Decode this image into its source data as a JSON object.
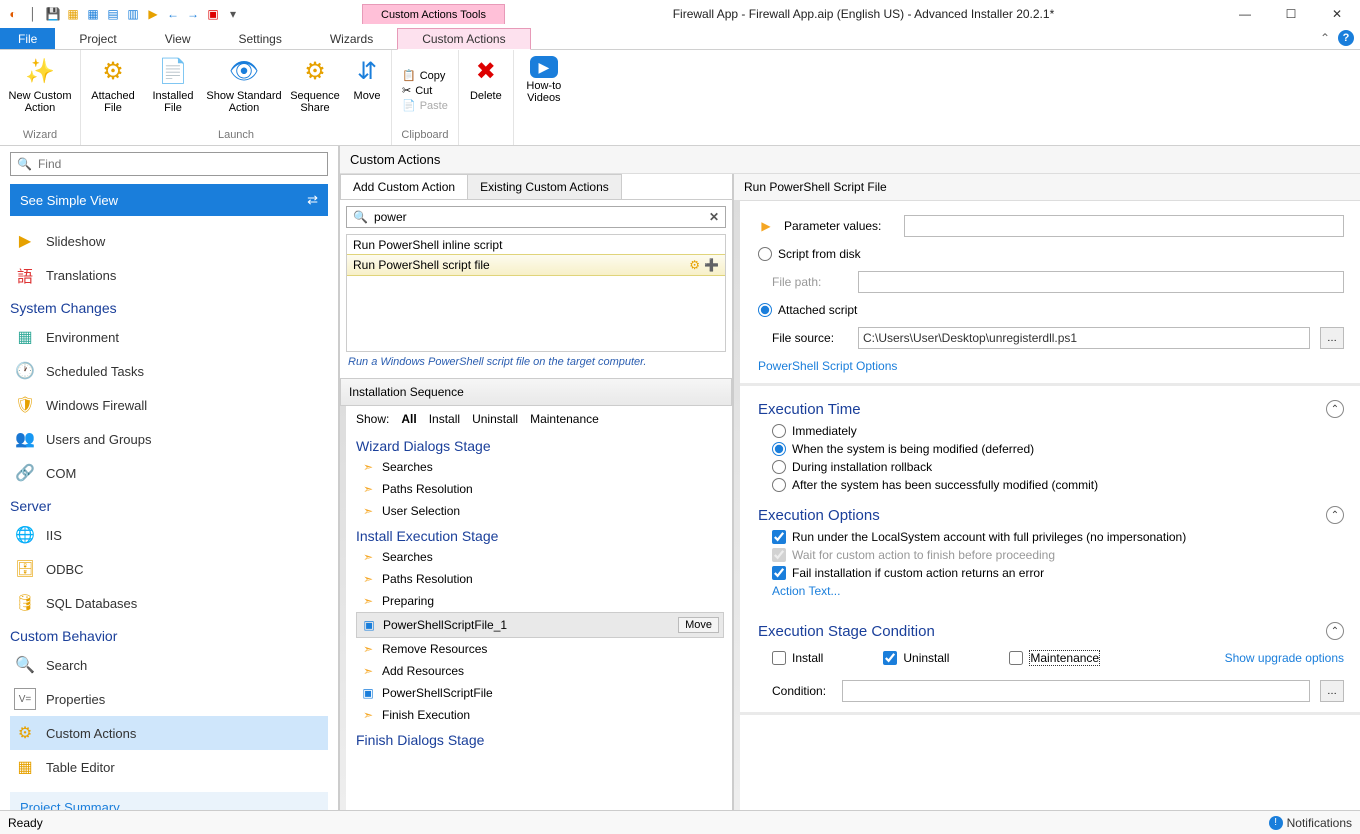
{
  "title_bar": {
    "tool_tab": "Custom Actions Tools",
    "window_title": "Firewall App - Firewall App.aip (English US) - Advanced Installer 20.2.1*"
  },
  "ribbon_tabs": {
    "file": "File",
    "project": "Project",
    "view": "View",
    "settings": "Settings",
    "wizards": "Wizards",
    "custom_actions": "Custom Actions"
  },
  "ribbon": {
    "wizard": {
      "new_ca": "New Custom\nAction",
      "group": "Wizard"
    },
    "launch": {
      "att_file": "Attached\nFile",
      "inst_file": "Installed\nFile",
      "std_action": "Show Standard\nAction",
      "seq_share": "Sequence\nShare",
      "move": "Move",
      "group": "Launch"
    },
    "clipboard": {
      "copy": "Copy",
      "cut": "Cut",
      "paste": "Paste",
      "group": "Clipboard"
    },
    "delete": "Delete",
    "videos": "How-to\nVideos"
  },
  "left": {
    "find_placeholder": "Find",
    "simple_view": "See Simple View",
    "items_top": [
      "Slideshow",
      "Translations"
    ],
    "cat_system": "System Changes",
    "sys_items": [
      "Environment",
      "Scheduled Tasks",
      "Windows Firewall",
      "Users and Groups",
      "COM"
    ],
    "cat_server": "Server",
    "server_items": [
      "IIS",
      "ODBC",
      "SQL Databases"
    ],
    "cat_behavior": "Custom Behavior",
    "behavior_items": [
      "Search",
      "Properties",
      "Custom Actions",
      "Table Editor"
    ],
    "project_summary": "Project Summary"
  },
  "center": {
    "title": "Custom Actions",
    "tab_add": "Add Custom Action",
    "tab_existing": "Existing Custom Actions",
    "search_value": "power",
    "result1": "Run PowerShell inline script",
    "result2": "Run PowerShell script file",
    "hint": "Run a Windows PowerShell script file on the target computer.",
    "seq_title": "Installation Sequence",
    "show_label": "Show:",
    "show_all": "All",
    "show_install": "Install",
    "show_uninstall": "Uninstall",
    "show_maint": "Maintenance",
    "stage_wizard": "Wizard Dialogs Stage",
    "wiz_items": [
      "Searches",
      "Paths Resolution",
      "User Selection"
    ],
    "stage_install": "Install Execution Stage",
    "inst_items": [
      "Searches",
      "Paths Resolution",
      "Preparing",
      "PowerShellScriptFile_1",
      "Remove Resources",
      "Add Resources",
      "PowerShellScriptFile",
      "Finish Execution"
    ],
    "move_btn": "Move",
    "stage_finish": "Finish Dialogs Stage"
  },
  "right": {
    "title": "Run PowerShell Script File",
    "param_label": "Parameter values:",
    "script_disk": "Script from disk",
    "file_path_label": "File path:",
    "attached_script": "Attached script",
    "file_source_label": "File source:",
    "file_source_value": "C:\\Users\\User\\Desktop\\unregisterdll.ps1",
    "ps_options": "PowerShell Script Options",
    "exec_time_title": "Execution Time",
    "et_immediately": "Immediately",
    "et_deferred": "When the system is being modified (deferred)",
    "et_rollback": "During installation rollback",
    "et_commit": "After the system has been successfully modified (commit)",
    "exec_options_title": "Execution Options",
    "eo_localsystem": "Run under the LocalSystem account with full privileges (no impersonation)",
    "eo_wait": "Wait for custom action to finish before proceeding",
    "eo_fail": "Fail installation if custom action returns an error",
    "action_text": "Action Text...",
    "exec_stage_title": "Execution Stage Condition",
    "stage_install": "Install",
    "stage_uninstall": "Uninstall",
    "stage_maint": "Maintenance",
    "show_upgrade": "Show upgrade options",
    "condition_label": "Condition:"
  },
  "status": {
    "ready": "Ready",
    "notifications": "Notifications"
  }
}
